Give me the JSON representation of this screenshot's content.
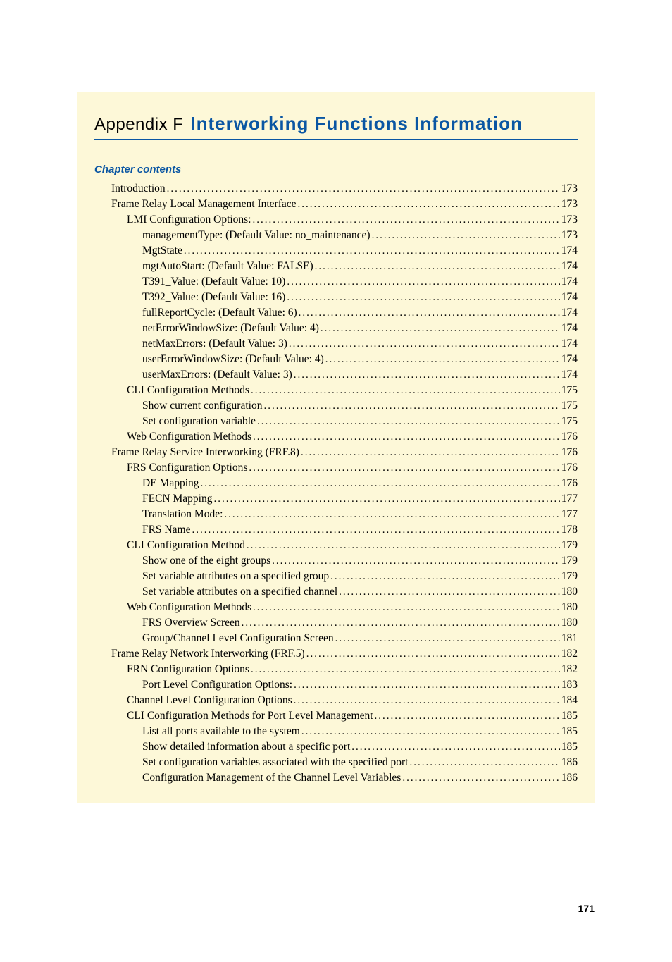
{
  "appendix_label": "Appendix F",
  "appendix_title": "Interworking Functions Information",
  "contents_heading": "Chapter contents",
  "page_number": "171",
  "toc": [
    {
      "indent": 0,
      "label": "Introduction",
      "page": "173"
    },
    {
      "indent": 0,
      "label": "Frame Relay Local Management Interface ",
      "page": "173"
    },
    {
      "indent": 1,
      "label": "LMI Configuration Options: ",
      "page": "173"
    },
    {
      "indent": 2,
      "label": "managementType: (Default Value: no_maintenance) ",
      "page": "173"
    },
    {
      "indent": 2,
      "label": "MgtState ",
      "page": "174"
    },
    {
      "indent": 2,
      "label": "mgtAutoStart: (Default Value: FALSE) ",
      "page": "174"
    },
    {
      "indent": 2,
      "label": "T391_Value: (Default Value: 10) ",
      "page": "174"
    },
    {
      "indent": 2,
      "label": "T392_Value: (Default Value: 16) ",
      "page": "174"
    },
    {
      "indent": 2,
      "label": "fullReportCycle: (Default Value: 6) ",
      "page": "174"
    },
    {
      "indent": 2,
      "label": "netErrorWindowSize: (Default Value: 4) ",
      "page": "174"
    },
    {
      "indent": 2,
      "label": "netMaxErrors: (Default Value: 3) ",
      "page": "174"
    },
    {
      "indent": 2,
      "label": "userErrorWindowSize: (Default Value: 4) ",
      "page": "174"
    },
    {
      "indent": 2,
      "label": "userMaxErrors: (Default Value: 3) ",
      "page": "174"
    },
    {
      "indent": 1,
      "label": "CLI Configuration Methods ",
      "page": "175"
    },
    {
      "indent": 2,
      "label": "Show current configuration ",
      "page": "175"
    },
    {
      "indent": 2,
      "label": "Set configuration variable ",
      "page": "175"
    },
    {
      "indent": 1,
      "label": "Web Configuration Methods ",
      "page": "176"
    },
    {
      "indent": 0,
      "label": "Frame Relay Service Interworking (FRF.8)",
      "page": "176"
    },
    {
      "indent": 1,
      "label": "FRS Configuration Options ",
      "page": "176"
    },
    {
      "indent": 2,
      "label": "DE Mapping ",
      "page": "176"
    },
    {
      "indent": 2,
      "label": "FECN Mapping ",
      "page": "177"
    },
    {
      "indent": 2,
      "label": "Translation Mode: ",
      "page": "177"
    },
    {
      "indent": 2,
      "label": "FRS Name ",
      "page": "178"
    },
    {
      "indent": 1,
      "label": "CLI Configuration Method ",
      "page": "179"
    },
    {
      "indent": 2,
      "label": "Show one of the eight groups ",
      "page": "179"
    },
    {
      "indent": 2,
      "label": "Set variable attributes on a specified group ",
      "page": "179"
    },
    {
      "indent": 2,
      "label": "Set variable attributes on a specified channel ",
      "page": "180"
    },
    {
      "indent": 1,
      "label": "Web Configuration Methods ",
      "page": "180"
    },
    {
      "indent": 2,
      "label": "FRS Overview Screen ",
      "page": "180"
    },
    {
      "indent": 2,
      "label": "Group/Channel Level Configuration Screen ",
      "page": "181"
    },
    {
      "indent": 0,
      "label": "Frame Relay Network Interworking (FRF.5)",
      "page": "182"
    },
    {
      "indent": 1,
      "label": "FRN Configuration Options ",
      "page": "182"
    },
    {
      "indent": 2,
      "label": "Port Level Configuration Options: ",
      "page": "183"
    },
    {
      "indent": 1,
      "label": "Channel Level Configuration Options ",
      "page": "184"
    },
    {
      "indent": 1,
      "label": "CLI Configuration Methods for Port Level Management ",
      "page": "185"
    },
    {
      "indent": 2,
      "label": "List all ports available to the system ",
      "page": "185"
    },
    {
      "indent": 2,
      "label": "Show detailed information about a specific port ",
      "page": "185"
    },
    {
      "indent": 2,
      "label": "Set configuration variables associated with the specified port ",
      "page": "186"
    },
    {
      "indent": 2,
      "label": "Configuration Management of the Channel Level Variables ",
      "page": "186"
    }
  ]
}
